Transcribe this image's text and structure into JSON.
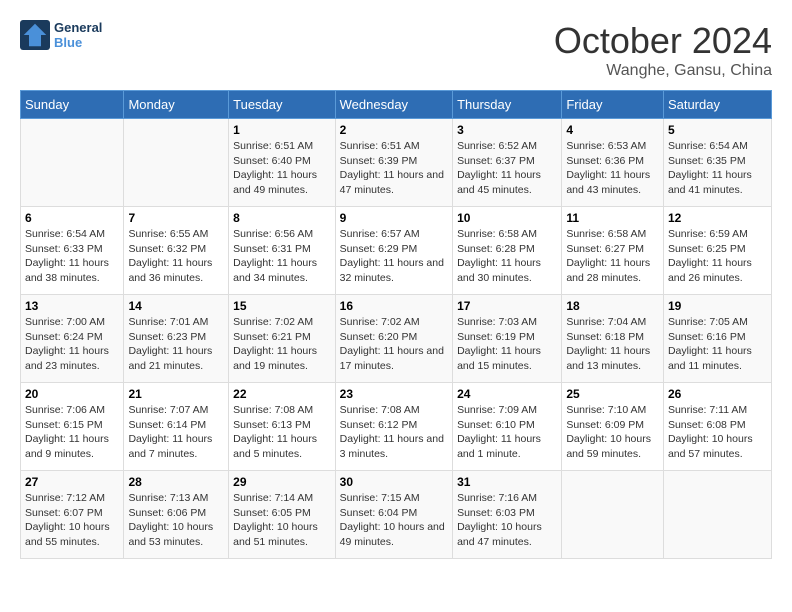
{
  "logo": {
    "text_general": "General",
    "text_blue": "Blue"
  },
  "title": "October 2024",
  "location": "Wanghe, Gansu, China",
  "days_of_week": [
    "Sunday",
    "Monday",
    "Tuesday",
    "Wednesday",
    "Thursday",
    "Friday",
    "Saturday"
  ],
  "weeks": [
    [
      {
        "day": "",
        "info": ""
      },
      {
        "day": "",
        "info": ""
      },
      {
        "day": "1",
        "info": "Sunrise: 6:51 AM\nSunset: 6:40 PM\nDaylight: 11 hours and 49 minutes."
      },
      {
        "day": "2",
        "info": "Sunrise: 6:51 AM\nSunset: 6:39 PM\nDaylight: 11 hours and 47 minutes."
      },
      {
        "day": "3",
        "info": "Sunrise: 6:52 AM\nSunset: 6:37 PM\nDaylight: 11 hours and 45 minutes."
      },
      {
        "day": "4",
        "info": "Sunrise: 6:53 AM\nSunset: 6:36 PM\nDaylight: 11 hours and 43 minutes."
      },
      {
        "day": "5",
        "info": "Sunrise: 6:54 AM\nSunset: 6:35 PM\nDaylight: 11 hours and 41 minutes."
      }
    ],
    [
      {
        "day": "6",
        "info": "Sunrise: 6:54 AM\nSunset: 6:33 PM\nDaylight: 11 hours and 38 minutes."
      },
      {
        "day": "7",
        "info": "Sunrise: 6:55 AM\nSunset: 6:32 PM\nDaylight: 11 hours and 36 minutes."
      },
      {
        "day": "8",
        "info": "Sunrise: 6:56 AM\nSunset: 6:31 PM\nDaylight: 11 hours and 34 minutes."
      },
      {
        "day": "9",
        "info": "Sunrise: 6:57 AM\nSunset: 6:29 PM\nDaylight: 11 hours and 32 minutes."
      },
      {
        "day": "10",
        "info": "Sunrise: 6:58 AM\nSunset: 6:28 PM\nDaylight: 11 hours and 30 minutes."
      },
      {
        "day": "11",
        "info": "Sunrise: 6:58 AM\nSunset: 6:27 PM\nDaylight: 11 hours and 28 minutes."
      },
      {
        "day": "12",
        "info": "Sunrise: 6:59 AM\nSunset: 6:25 PM\nDaylight: 11 hours and 26 minutes."
      }
    ],
    [
      {
        "day": "13",
        "info": "Sunrise: 7:00 AM\nSunset: 6:24 PM\nDaylight: 11 hours and 23 minutes."
      },
      {
        "day": "14",
        "info": "Sunrise: 7:01 AM\nSunset: 6:23 PM\nDaylight: 11 hours and 21 minutes."
      },
      {
        "day": "15",
        "info": "Sunrise: 7:02 AM\nSunset: 6:21 PM\nDaylight: 11 hours and 19 minutes."
      },
      {
        "day": "16",
        "info": "Sunrise: 7:02 AM\nSunset: 6:20 PM\nDaylight: 11 hours and 17 minutes."
      },
      {
        "day": "17",
        "info": "Sunrise: 7:03 AM\nSunset: 6:19 PM\nDaylight: 11 hours and 15 minutes."
      },
      {
        "day": "18",
        "info": "Sunrise: 7:04 AM\nSunset: 6:18 PM\nDaylight: 11 hours and 13 minutes."
      },
      {
        "day": "19",
        "info": "Sunrise: 7:05 AM\nSunset: 6:16 PM\nDaylight: 11 hours and 11 minutes."
      }
    ],
    [
      {
        "day": "20",
        "info": "Sunrise: 7:06 AM\nSunset: 6:15 PM\nDaylight: 11 hours and 9 minutes."
      },
      {
        "day": "21",
        "info": "Sunrise: 7:07 AM\nSunset: 6:14 PM\nDaylight: 11 hours and 7 minutes."
      },
      {
        "day": "22",
        "info": "Sunrise: 7:08 AM\nSunset: 6:13 PM\nDaylight: 11 hours and 5 minutes."
      },
      {
        "day": "23",
        "info": "Sunrise: 7:08 AM\nSunset: 6:12 PM\nDaylight: 11 hours and 3 minutes."
      },
      {
        "day": "24",
        "info": "Sunrise: 7:09 AM\nSunset: 6:10 PM\nDaylight: 11 hours and 1 minute."
      },
      {
        "day": "25",
        "info": "Sunrise: 7:10 AM\nSunset: 6:09 PM\nDaylight: 10 hours and 59 minutes."
      },
      {
        "day": "26",
        "info": "Sunrise: 7:11 AM\nSunset: 6:08 PM\nDaylight: 10 hours and 57 minutes."
      }
    ],
    [
      {
        "day": "27",
        "info": "Sunrise: 7:12 AM\nSunset: 6:07 PM\nDaylight: 10 hours and 55 minutes."
      },
      {
        "day": "28",
        "info": "Sunrise: 7:13 AM\nSunset: 6:06 PM\nDaylight: 10 hours and 53 minutes."
      },
      {
        "day": "29",
        "info": "Sunrise: 7:14 AM\nSunset: 6:05 PM\nDaylight: 10 hours and 51 minutes."
      },
      {
        "day": "30",
        "info": "Sunrise: 7:15 AM\nSunset: 6:04 PM\nDaylight: 10 hours and 49 minutes."
      },
      {
        "day": "31",
        "info": "Sunrise: 7:16 AM\nSunset: 6:03 PM\nDaylight: 10 hours and 47 minutes."
      },
      {
        "day": "",
        "info": ""
      },
      {
        "day": "",
        "info": ""
      }
    ]
  ]
}
